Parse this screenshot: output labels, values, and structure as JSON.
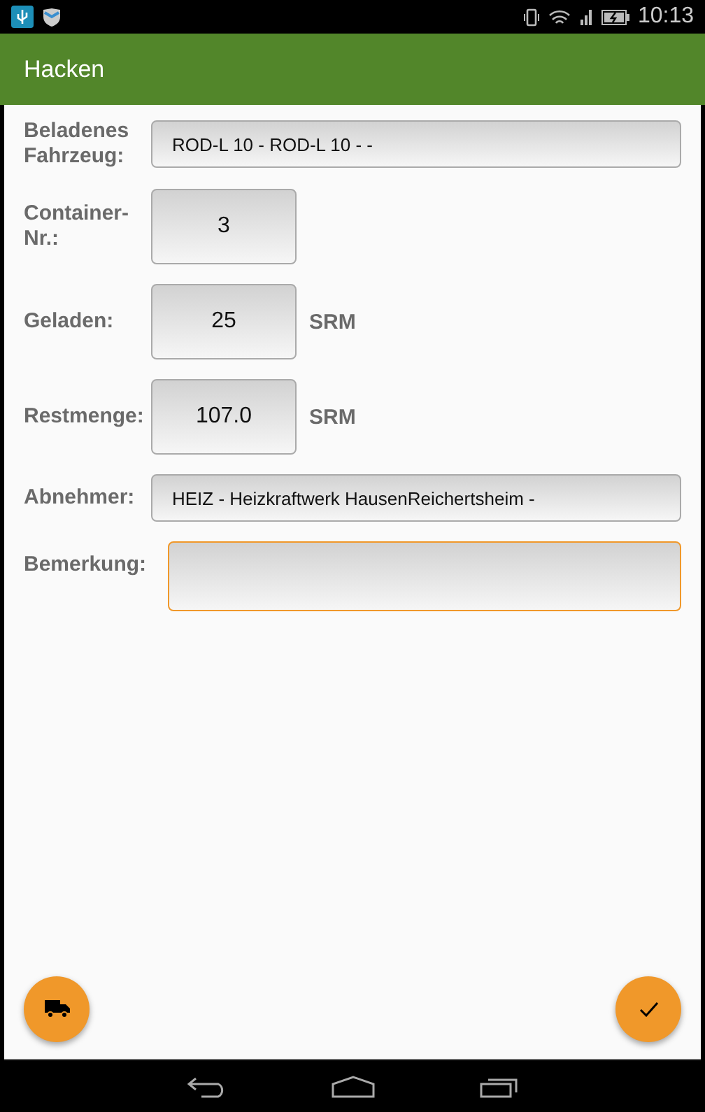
{
  "status_bar": {
    "time": "10:13"
  },
  "app_bar": {
    "title": "Hacken"
  },
  "fields": [
    {
      "kind": "wide",
      "label": "Beladenes Fahrzeug:",
      "value": "ROD-L 10 - ROD-L 10 -  -",
      "focused": false
    },
    {
      "kind": "small",
      "label": "Container-Nr.:",
      "value": "3",
      "focused": false
    },
    {
      "kind": "small",
      "label": "Geladen:",
      "value": "25",
      "unit": "SRM",
      "focused": false
    },
    {
      "kind": "small",
      "label": "Restmenge:",
      "value": "107.0",
      "unit": "SRM",
      "focused": false
    },
    {
      "kind": "wide",
      "label": "Abnehmer:",
      "value": "HEIZ - Heizkraftwerk HausenReichertsheim -",
      "focused": false
    },
    {
      "kind": "remark",
      "label": "Bemerkung:",
      "focused": true
    }
  ]
}
